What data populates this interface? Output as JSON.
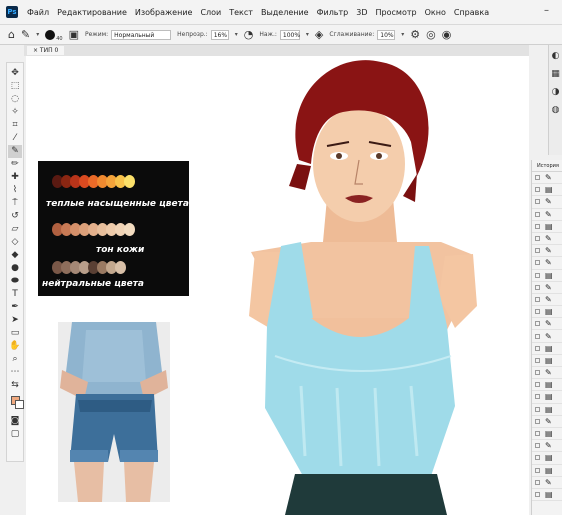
{
  "menubar": {
    "logo": "Ps",
    "items": [
      "Файл",
      "Редактирование",
      "Изображение",
      "Слои",
      "Текст",
      "Выделение",
      "Фильтр",
      "3D",
      "Просмотр",
      "Окно",
      "Справка"
    ]
  },
  "options": {
    "brush_size": "40",
    "mode_label": "Режим:",
    "mode_value": "Нормальный",
    "opacity_label": "Непрозр.:",
    "opacity_value": "16%",
    "pressure_label": "Наж.:",
    "pressure_value": "100%",
    "smoothing_label": "Сглаживание:",
    "smoothing_value": "10%"
  },
  "document": {
    "tab_label": "× ТИП 0"
  },
  "palette": {
    "warm_label": "теплые насыщенные цвета",
    "skin_label": "тон кожи",
    "neutral_label": "нейтральные цвета",
    "warm_colors": [
      "#5a1a12",
      "#8a2612",
      "#b8341a",
      "#d94a20",
      "#ea6a28",
      "#f08a30",
      "#f4a33a",
      "#f8c24a",
      "#fbe06a"
    ],
    "skin_colors": [
      "#b06040",
      "#c87a55",
      "#d4906a",
      "#dba07a",
      "#e3b08c",
      "#e8bf9c",
      "#eecbaa",
      "#f1d4b6",
      "#f3dcc0"
    ],
    "neutral_colors": [
      "#7a5848",
      "#8e6e5c",
      "#a48876",
      "#b89e8a",
      "#5a4034",
      "#9a7a62",
      "#c3a88e",
      "#d8c0a8"
    ]
  },
  "history": {
    "title": "История",
    "rows": 27
  },
  "colors": {
    "foreground": "#f0a97f",
    "background": "#ffffff",
    "accent": "#31a8ff"
  }
}
